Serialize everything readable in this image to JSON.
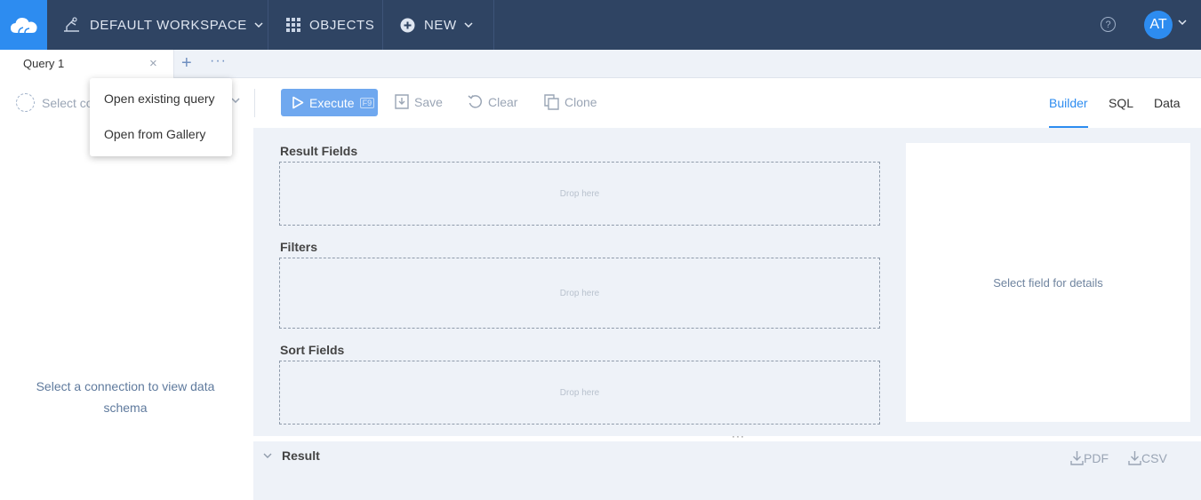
{
  "topbar": {
    "workspace_label": "DEFAULT WORKSPACE",
    "objects_label": "OBJECTS",
    "new_label": "NEW",
    "help_glyph": "?",
    "avatar_initials": "AT",
    "icons": [
      "cloud-logo-icon",
      "workspace-icon",
      "grid-icon",
      "plus-circle-icon",
      "chevron-down-icon",
      "help-icon"
    ]
  },
  "tabs": {
    "items": [
      {
        "label": "Query 1"
      }
    ],
    "close_glyph": "×",
    "add_glyph": "+",
    "more_glyph": "···"
  },
  "toolbar": {
    "connection_placeholder": "Select co",
    "execute_label": "Execute",
    "execute_key": "F9",
    "save_label": "Save",
    "clear_label": "Clear",
    "clone_label": "Clone",
    "modes": [
      "Builder",
      "SQL",
      "Data"
    ],
    "active_mode": "Builder"
  },
  "menu": {
    "items": [
      "Open existing query",
      "Open from Gallery"
    ]
  },
  "left_panel": {
    "message_line1": "Select a connection to view data",
    "message_line2": "schema"
  },
  "builder": {
    "result_fields_label": "Result Fields",
    "filters_label": "Filters",
    "sort_fields_label": "Sort Fields",
    "drop_placeholder": "Drop here",
    "details_message": "Select field for details"
  },
  "result": {
    "title": "Result",
    "pdf_label": "PDF",
    "csv_label": "CSV",
    "splitter_glyph": "···"
  },
  "colors": {
    "nav_bg": "#2f4463",
    "accent": "#2d8cf0",
    "panel_bg": "#eef2f8"
  }
}
